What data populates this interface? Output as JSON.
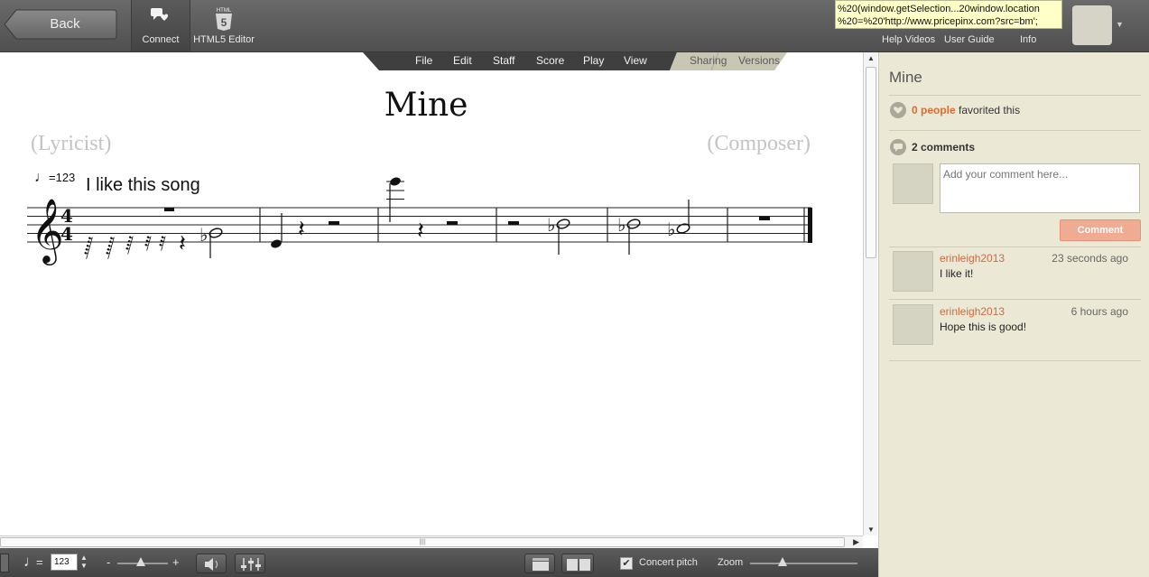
{
  "topbar": {
    "back_label": "Back",
    "tools": [
      {
        "label": "Connect",
        "icon": "chat-bubbles-icon"
      },
      {
        "label": "HTML5 Editor",
        "icon": "html5-icon"
      }
    ],
    "url_tooltip": {
      "line1": "%20(window.getSelection...20window.location",
      "line2": "%20=%20'http://www.pricepinx.com?src=bm';"
    },
    "links": [
      "Help Videos",
      "User Guide",
      "Info"
    ]
  },
  "menu": {
    "items": [
      "File",
      "Edit",
      "Staff",
      "Score",
      "Play",
      "View"
    ],
    "tabs": [
      "Sharing",
      "Versions"
    ]
  },
  "score": {
    "title": "Mine",
    "lyricist": "(Lyricist)",
    "composer": "(Composer)",
    "tempo_note": "♩",
    "tempo_eq": "=",
    "tempo_value": "123",
    "staff_text": "I like this song",
    "time_signature": {
      "top": "4",
      "bottom": "4"
    }
  },
  "bottombar": {
    "tempo_note": "♩",
    "tempo_eq": "=",
    "tempo_value": "123",
    "minus": "-",
    "plus": "+",
    "concert_pitch_label": "Concert pitch",
    "concert_pitch_checked": "✔",
    "zoom_label": "Zoom"
  },
  "panel": {
    "title": "Mine",
    "favorites_count": "0 people",
    "favorites_suffix": "favorited this",
    "comments_count": "2 comments",
    "comment_placeholder": "Add your comment here...",
    "comment_button": "Comment",
    "comments": [
      {
        "user": "erinleigh2013",
        "time": "23 seconds ago",
        "text": "I like it!"
      },
      {
        "user": "erinleigh2013",
        "time": "6 hours ago",
        "text": "Hope this is good!"
      }
    ]
  },
  "colors": {
    "accent_orange": "#e06a2e",
    "panel_bg": "#ebe9d6",
    "toolbar_dark": "#4f4f4f"
  }
}
